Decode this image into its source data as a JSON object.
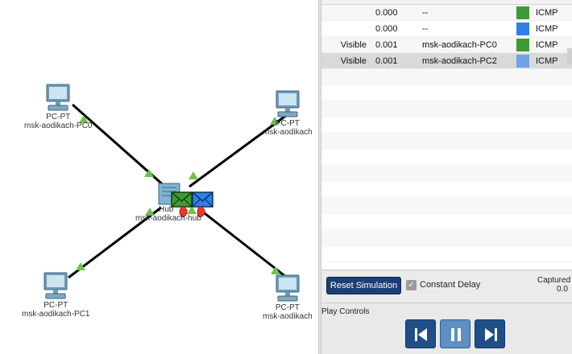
{
  "workspace": {
    "pc0": {
      "type": "PC-PT",
      "name": "msk-aodikach-PC0"
    },
    "pc1": {
      "type": "PC-PT",
      "name": "msk-aodikach-PC1"
    },
    "pc2": {
      "type": "PC-PT",
      "name": "msk-aodikach"
    },
    "pc3": {
      "type": "PC-PT",
      "name": "msk-aodikach"
    },
    "hub": {
      "type": "Hub",
      "name": "msk-aodikach-hub"
    }
  },
  "events": [
    {
      "visible": "",
      "time": "0.000",
      "device": "--",
      "color": "#3d9a35",
      "type": "ICMP"
    },
    {
      "visible": "",
      "time": "0.000",
      "device": "--",
      "color": "#2f7fe6",
      "type": "ICMP"
    },
    {
      "visible": "Visible",
      "time": "0.001",
      "device": "msk-aodikach-PC0",
      "color": "#3d9a35",
      "type": "ICMP"
    },
    {
      "visible": "Visible",
      "time": "0.001",
      "device": "msk-aodikach-PC2",
      "color": "#6fa4e8",
      "type": "ICMP",
      "selected": true
    }
  ],
  "controls": {
    "reset_label": "Reset Simulation",
    "constant_delay_label": "Constant Delay",
    "constant_delay_checked": true,
    "captured_label": "Captured",
    "captured_value": "0.0"
  },
  "play": {
    "title": "Play Controls",
    "buttons": [
      "back-icon",
      "pause-icon",
      "forward-icon"
    ]
  },
  "colors": {
    "reset_bg": "#1c3f73",
    "play_bg": "#1f4f86",
    "play_active": "#5d8fc4",
    "link_triangle": "#6cc24a"
  }
}
